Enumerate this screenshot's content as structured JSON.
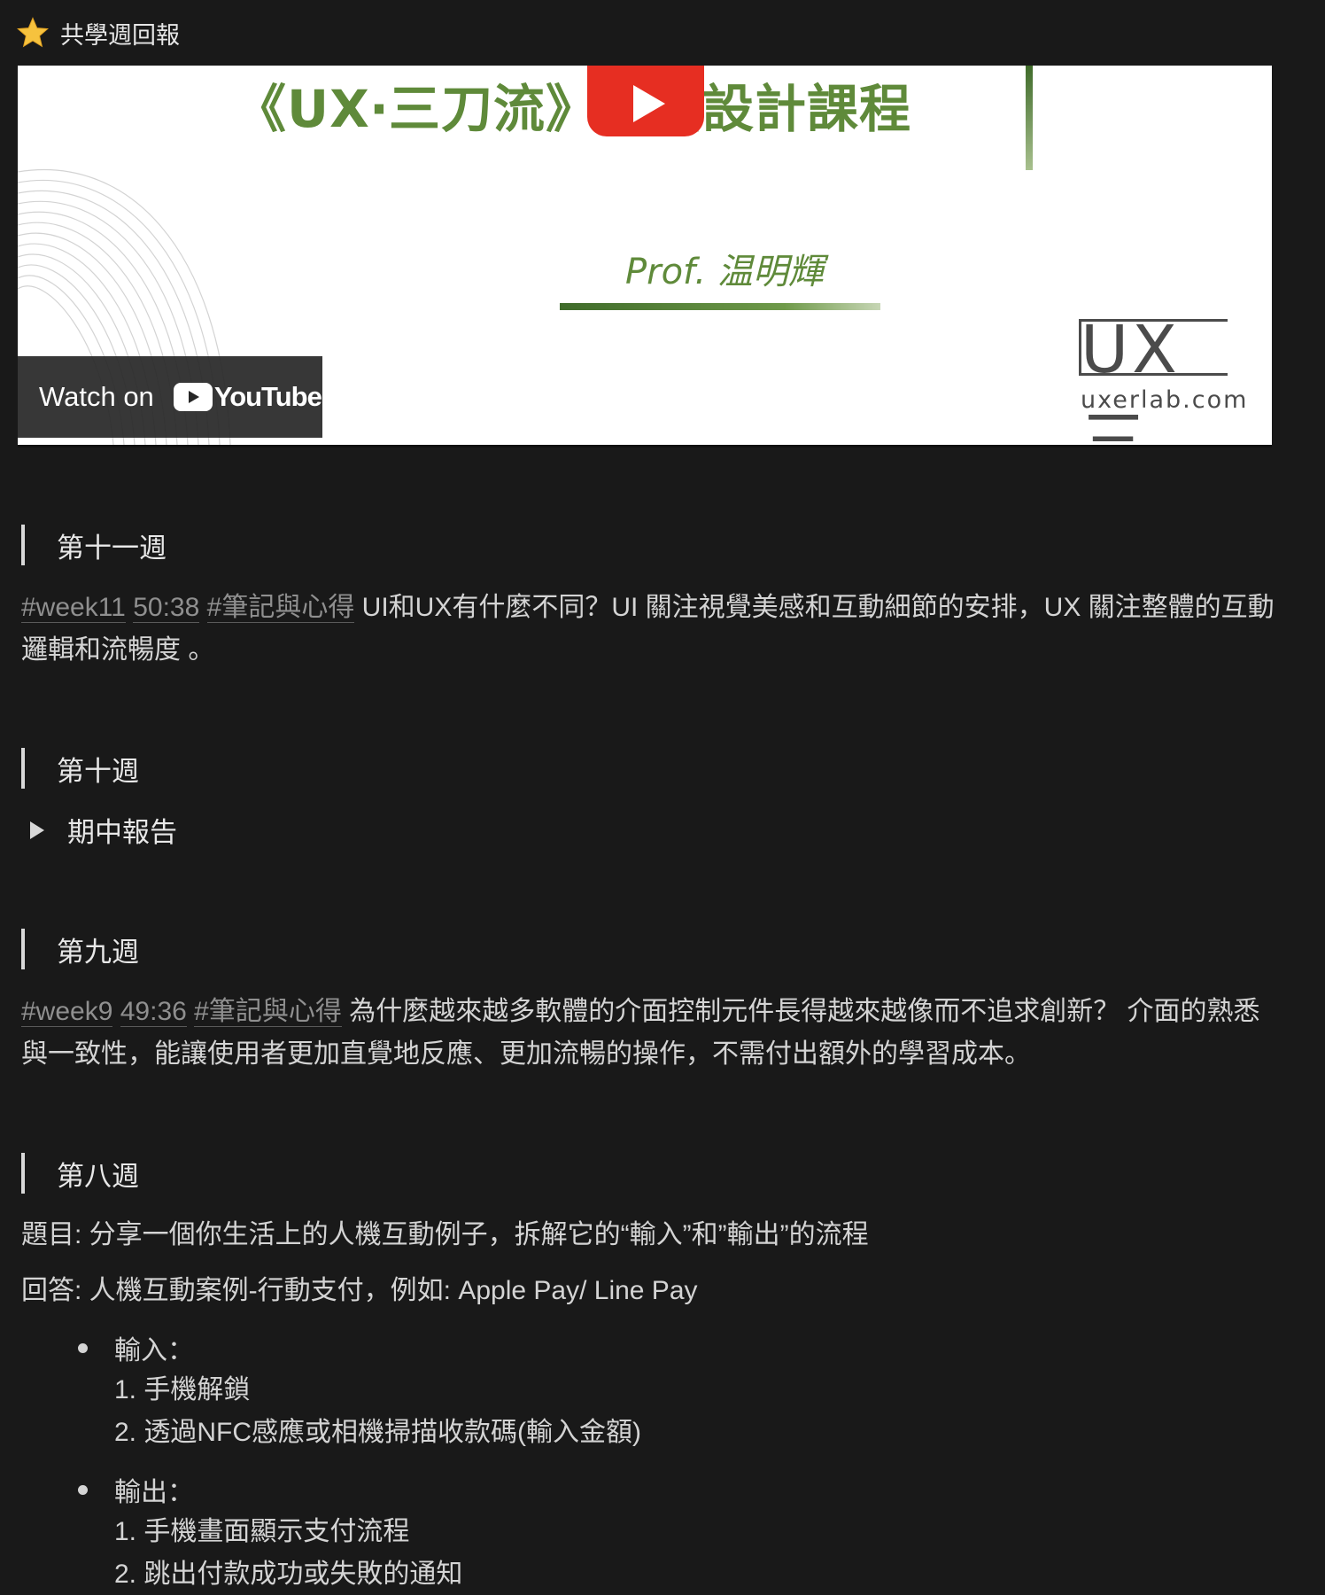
{
  "page": {
    "title": "共學週回報"
  },
  "video": {
    "course_title": "《UX‧三刀流》產品設計課程",
    "prof": "Prof. 温明輝",
    "brand": "UX 三",
    "site": "uxerlab.com",
    "watch_on": "Watch on",
    "youtube": "YouTube"
  },
  "week11": {
    "heading": "第十一週",
    "tag_week": "#week11",
    "tag_time": "50:38",
    "tag_note": "#筆記與心得",
    "text": " UI和UX有什麼不同？UI 關注視覺美感和互動細節的安排，UX 關注整體的互動邏輯和流暢度 。"
  },
  "week10": {
    "heading": "第十週",
    "toggle_label": "期中報告"
  },
  "week9": {
    "heading": "第九週",
    "tag_week": "#week9",
    "tag_time": "49:36",
    "tag_note": "#筆記與心得",
    "text": " 為什麼越來越多軟體的介面控制元件長得越來越像而不追求創新？ 介面的熟悉與一致性，能讓使用者更加直覺地反應、更加流暢的操作，不需付出額外的學習成本。"
  },
  "week8": {
    "heading": "第八週",
    "question": "題目: 分享一個你生活上的人機互動例子，拆解它的“輸入”和”輸出”的流程",
    "answer": "回答: 人機互動案例-行動支付，例如: Apple Pay/ Line Pay",
    "input_label": "輸入：",
    "input_items": [
      "1. 手機解鎖",
      "2. 透過NFC感應或相機掃描收款碼(輸入金額)"
    ],
    "output_label": "輸出：",
    "output_items": [
      "1. 手機畫面顯示支付流程",
      "2. 跳出付款成功或失敗的通知"
    ]
  },
  "colors": {
    "background": "#191919",
    "tag_gray": "#8f8f8f",
    "course_green": "#5f8a3a",
    "youtube_red": "#e62e22"
  }
}
